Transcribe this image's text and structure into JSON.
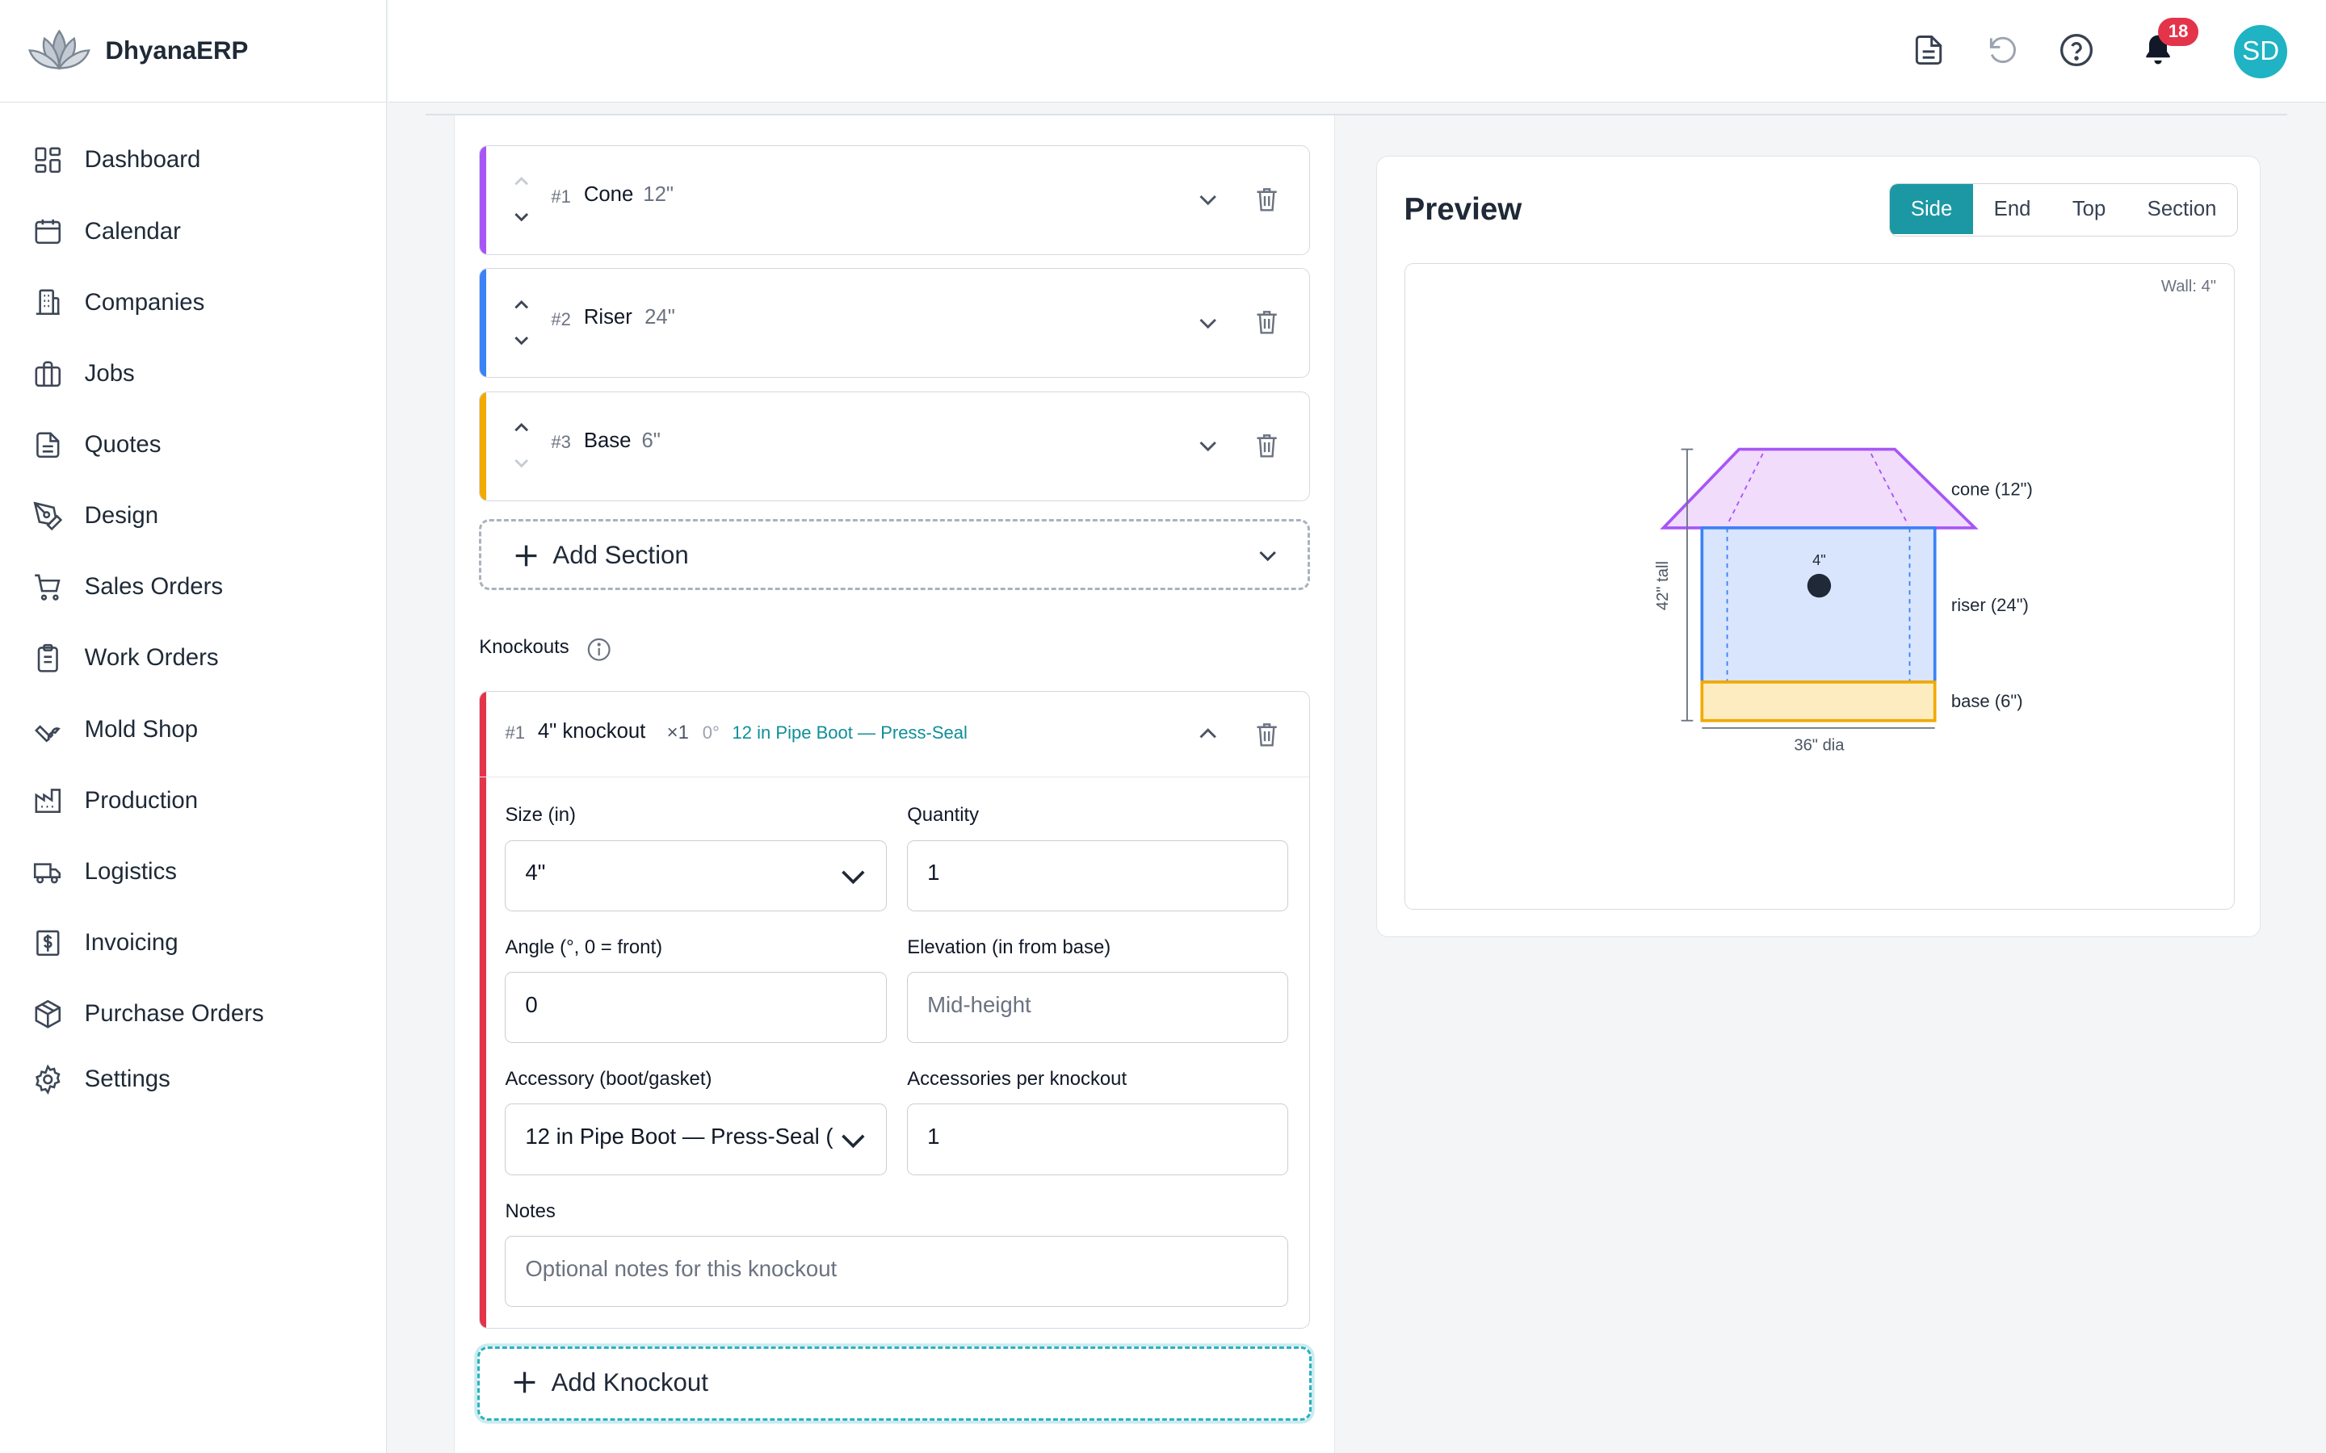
{
  "brand": {
    "name": "DhyanaERP"
  },
  "sidebar": {
    "items": [
      {
        "label": "Dashboard",
        "icon": "dashboard-icon"
      },
      {
        "label": "Calendar",
        "icon": "calendar-icon"
      },
      {
        "label": "Companies",
        "icon": "building-icon"
      },
      {
        "label": "Jobs",
        "icon": "briefcase-icon"
      },
      {
        "label": "Quotes",
        "icon": "document-icon"
      },
      {
        "label": "Design",
        "icon": "pen-tool-icon"
      },
      {
        "label": "Sales Orders",
        "icon": "cart-icon"
      },
      {
        "label": "Work Orders",
        "icon": "clipboard-icon"
      },
      {
        "label": "Mold Shop",
        "icon": "wrench-icon"
      },
      {
        "label": "Production",
        "icon": "factory-icon"
      },
      {
        "label": "Logistics",
        "icon": "truck-icon"
      },
      {
        "label": "Invoicing",
        "icon": "invoice-icon"
      },
      {
        "label": "Purchase Orders",
        "icon": "package-icon"
      },
      {
        "label": "Settings",
        "icon": "gear-icon"
      }
    ]
  },
  "topbar": {
    "notification_count": "18",
    "avatar_initials": "SD"
  },
  "sections": [
    {
      "num": "#1",
      "name": "Cone",
      "size": "12\"",
      "color": "#a855f7"
    },
    {
      "num": "#2",
      "name": "Riser",
      "size": "24\"",
      "color": "#3b82f6"
    },
    {
      "num": "#3",
      "name": "Base",
      "size": "6\"",
      "color": "#f2a900"
    }
  ],
  "add_section_label": "Add Section",
  "knockouts": {
    "label": "Knockouts",
    "items": [
      {
        "num": "#1",
        "title": "4\" knockout",
        "qty": "×1",
        "angle": "0°",
        "accessory_summary": "12 in Pipe Boot — Press-Seal",
        "fields": {
          "size_label": "Size (in)",
          "size_value": "4\"",
          "quantity_label": "Quantity",
          "quantity_value": "1",
          "angle_label": "Angle (°, 0 = front)",
          "angle_value": "0",
          "elevation_label": "Elevation (in from base)",
          "elevation_placeholder": "Mid-height",
          "accessory_label": "Accessory (boot/gasket)",
          "accessory_value": "12 in Pipe Boot — Press-Seal (",
          "per_knockout_label": "Accessories per knockout",
          "per_knockout_value": "1",
          "notes_label": "Notes",
          "notes_placeholder": "Optional notes for this knockout"
        }
      }
    ]
  },
  "add_knockout_label": "Add Knockout",
  "preview": {
    "title": "Preview",
    "views": [
      "Side",
      "End",
      "Top",
      "Section"
    ],
    "active_view": "Side",
    "wall_label": "Wall: 4\"",
    "drawing": {
      "cone_label": "cone (12\")",
      "riser_label": "riser (24\")",
      "base_label": "base (6\")",
      "height_label": "42\" tall",
      "dia_label": "36\" dia",
      "knockout_label": "4\""
    }
  }
}
